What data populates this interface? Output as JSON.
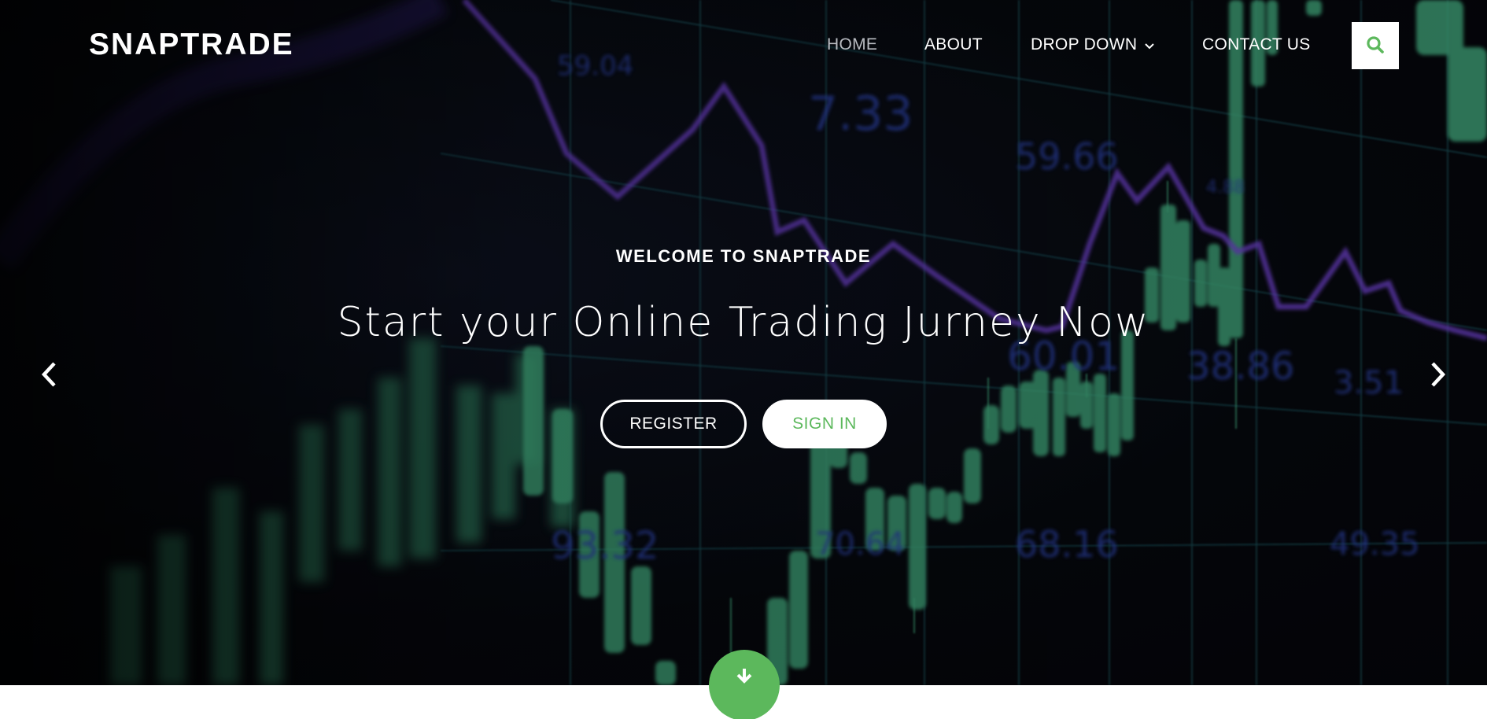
{
  "brand": {
    "name": "SNAPTRADE"
  },
  "nav": {
    "items": [
      {
        "label": "HOME",
        "active": true
      },
      {
        "label": "ABOUT",
        "active": false
      },
      {
        "label": "DROP DOWN",
        "active": false,
        "has_dropdown": true
      },
      {
        "label": "CONTACT US",
        "active": false
      }
    ],
    "search_icon": "search-icon"
  },
  "hero": {
    "subtitle": "WELCOME TO SNAPTRADE",
    "headline": "Start your Online Trading Jurney Now",
    "buttons": {
      "register": "REGISTER",
      "signin": "SIGN IN"
    },
    "background_numbers": [
      "59.04",
      "7.33",
      "59.66",
      "4.88",
      "60.01",
      "38.86",
      "3.51",
      "93.32",
      "70.64",
      "68.16",
      "49.35"
    ]
  },
  "carousel": {
    "prev_icon": "chevron-left-icon",
    "next_icon": "chevron-right-icon"
  },
  "scroll": {
    "icon": "arrow-down-icon"
  },
  "colors": {
    "accent": "#5cb85c",
    "purple_line": "#6b3fc4",
    "grid_line": "#1f5a63",
    "candle": "#3fa57a"
  }
}
